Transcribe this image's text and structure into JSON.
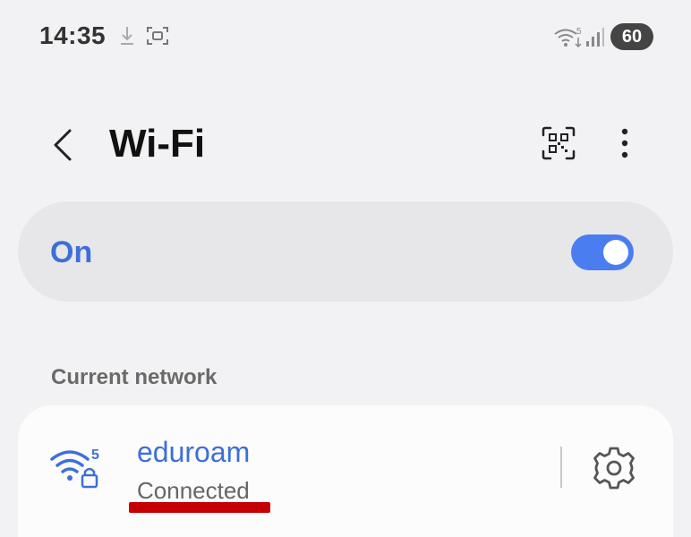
{
  "status_bar": {
    "time": "14:35",
    "download_icon": "download-icon",
    "screenshot_icon": "screenshot-icon",
    "wifi_icon": "wifi-signal-icon",
    "cell_icon": "cell-signal-icon",
    "battery": "60"
  },
  "header": {
    "title": "Wi-Fi",
    "back_icon": "back-arrow-icon",
    "qr_icon": "qr-code-scanner-icon",
    "more_icon": "more-options-icon"
  },
  "toggle": {
    "label": "On",
    "state": true,
    "accent": "#4a7df0"
  },
  "current_network": {
    "section_label": "Current network",
    "name": "eduroam",
    "status": "Connected",
    "wifi_band": "5",
    "icon": "wifi-secured-icon",
    "settings_icon": "gear-icon"
  },
  "colors": {
    "accent_text": "#3d6fd9",
    "annotation": "#c40000",
    "background": "#f2f2f4"
  }
}
